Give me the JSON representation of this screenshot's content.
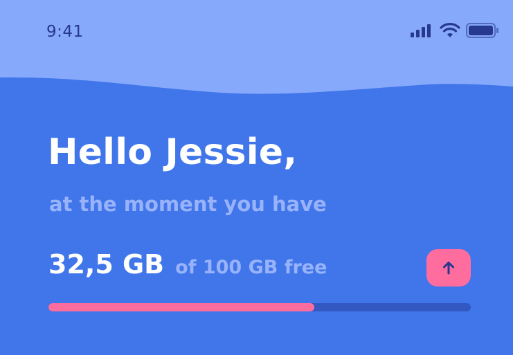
{
  "status_bar": {
    "time": "9:41",
    "icons": [
      "cellular-signal-icon",
      "wifi-icon",
      "battery-icon"
    ]
  },
  "greeting": {
    "title": "Hello Jessie,",
    "subtitle": "at the moment you have"
  },
  "storage": {
    "value": "32,5 GB",
    "total": "of 100 GB free",
    "progress_fraction": 0.63
  },
  "actions": {
    "upload_icon": "arrow-up-icon"
  },
  "colors": {
    "background": "#4076ea",
    "wave": "#87a9fb",
    "accent": "#ff6d9f",
    "muted_text": "#98b3fb",
    "track": "#3458c2"
  }
}
